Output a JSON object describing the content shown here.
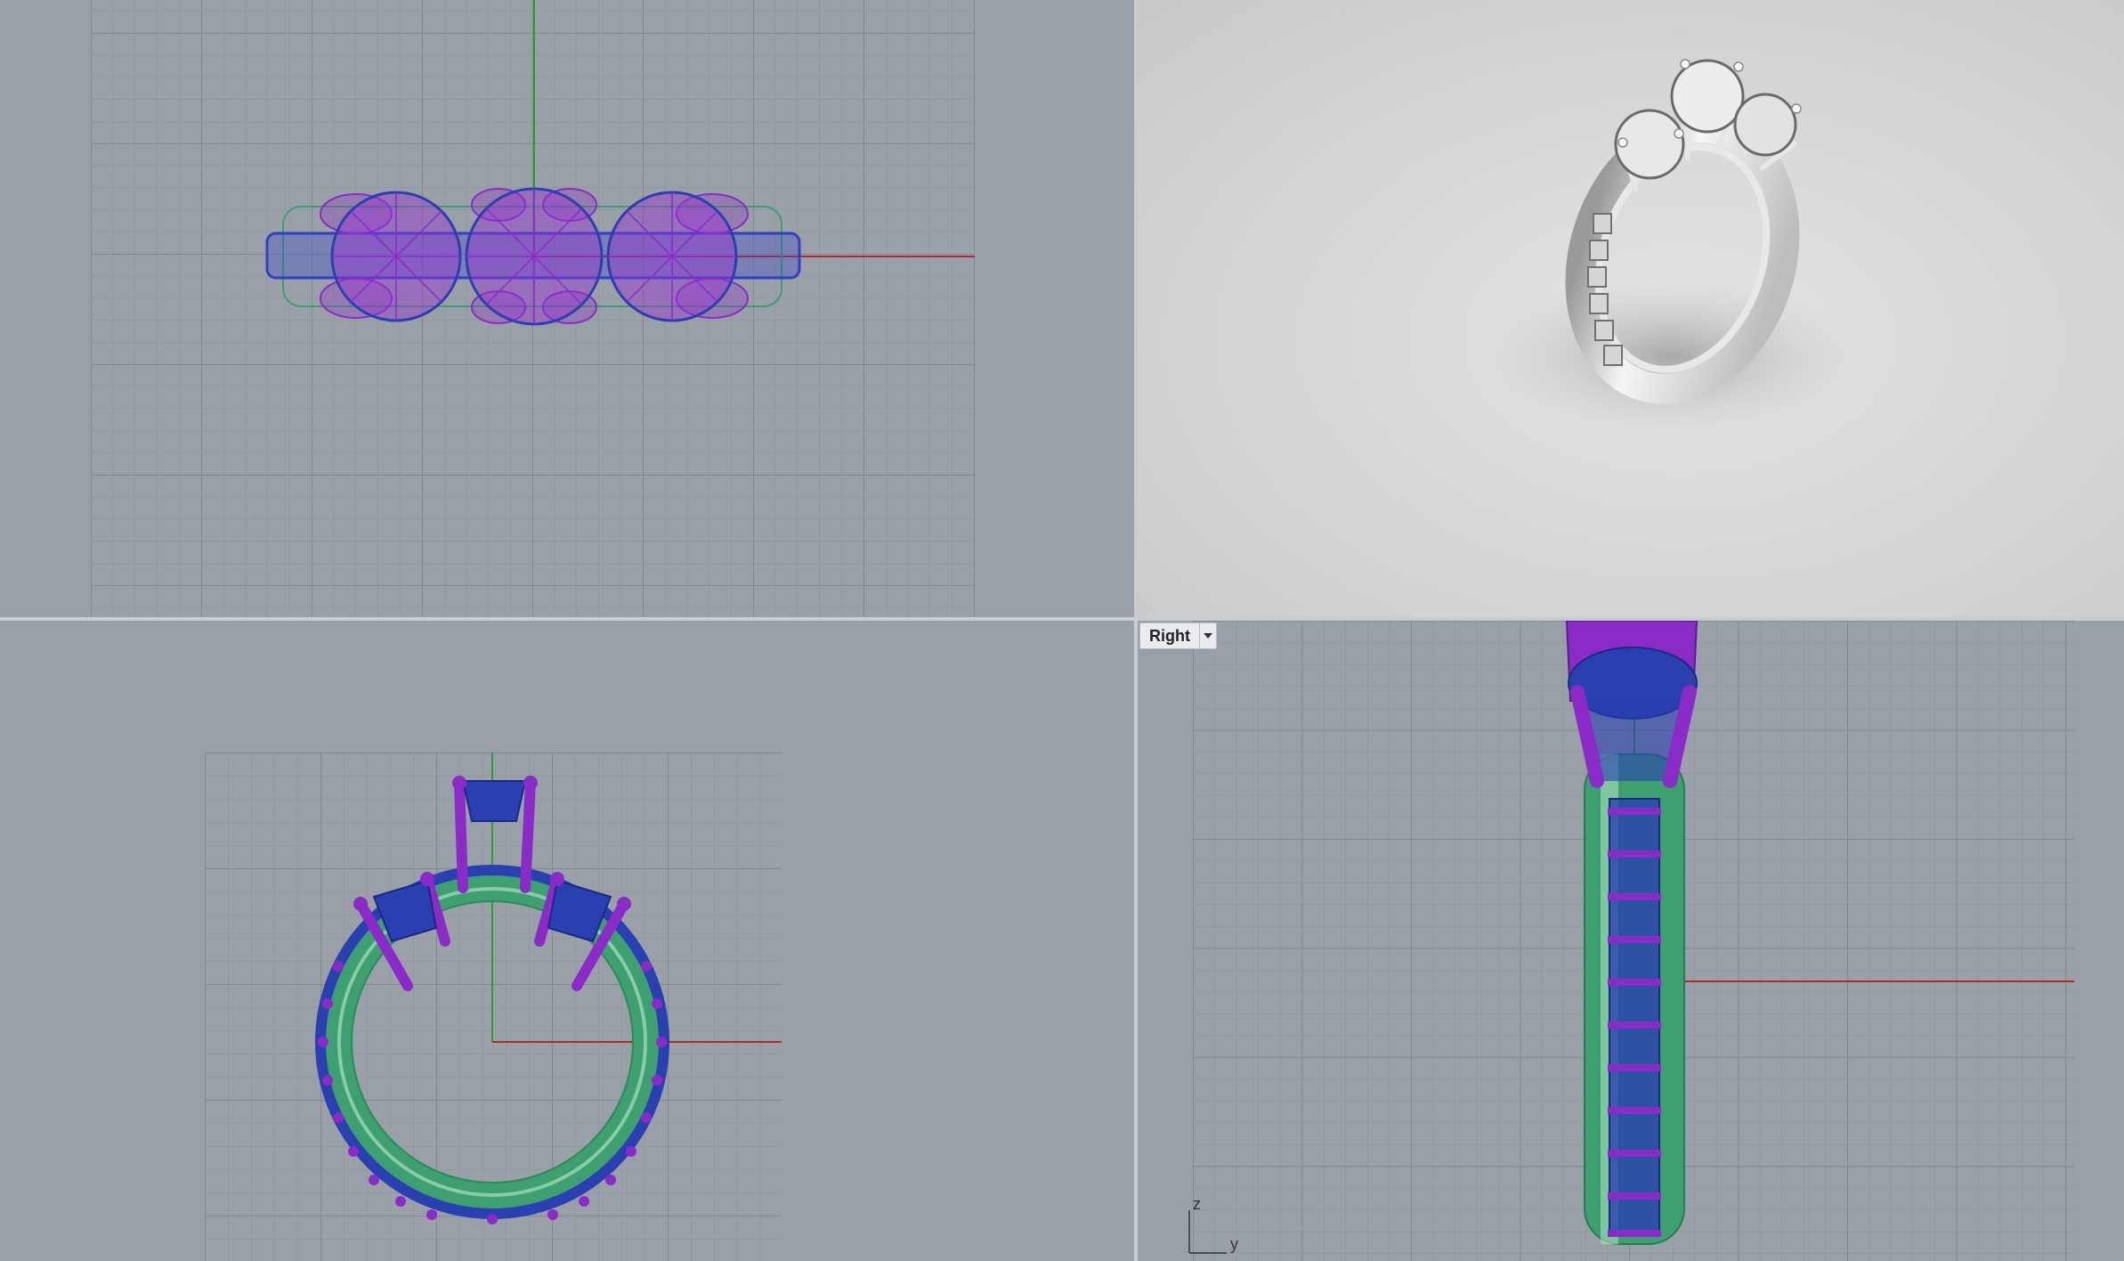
{
  "viewports": {
    "top": {
      "label": ""
    },
    "perspective": {
      "label": ""
    },
    "front": {
      "label": ""
    },
    "right": {
      "label": "Right",
      "axis_z": "z",
      "axis_y": "y"
    }
  },
  "colors": {
    "viewport_bg": "#9aa0a8",
    "grid_minor": "#8d939b",
    "grid_major": "#7d838b",
    "axis_x": "#b02a2a",
    "axis_y": "#2a9a3a",
    "prongs": "#8a2bc8",
    "gems": "#2a3fb0",
    "band": "#3ea070",
    "render_metal": "#f2f2f2"
  }
}
